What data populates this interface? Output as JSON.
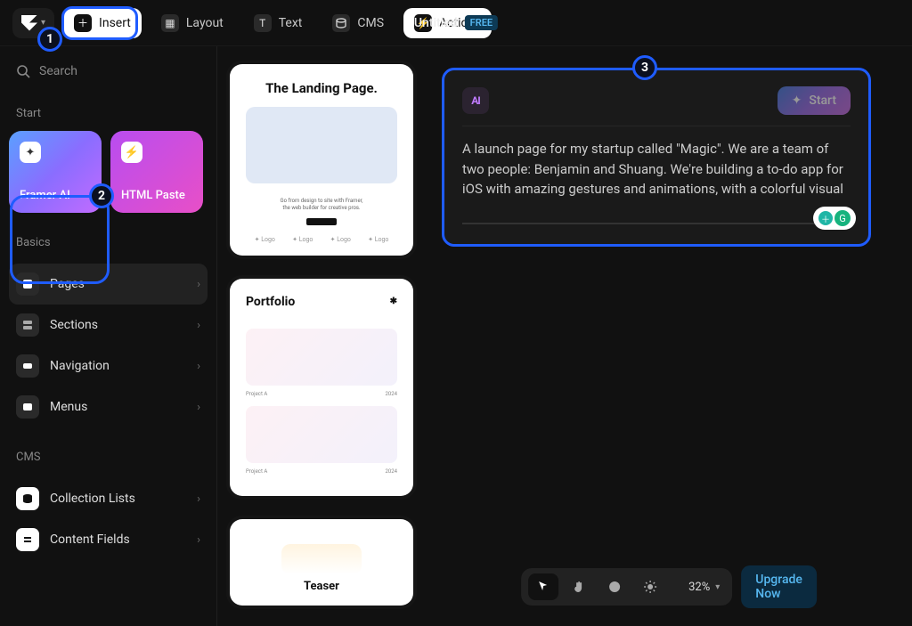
{
  "toolbar": {
    "insert": "Insert",
    "layout": "Layout",
    "text": "Text",
    "cms": "CMS",
    "actions": "Actions"
  },
  "doc": {
    "title": "Untitled",
    "plan_badge": "FREE"
  },
  "left": {
    "search_placeholder": "Search",
    "start_label": "Start",
    "tile_ai": "Framer AI",
    "tile_html": "HTML Paste",
    "basics_label": "Basics",
    "basics": [
      {
        "label": "Pages"
      },
      {
        "label": "Sections"
      },
      {
        "label": "Navigation"
      },
      {
        "label": "Menus"
      }
    ],
    "cms_label": "CMS",
    "cms": [
      {
        "label": "Collection Lists"
      },
      {
        "label": "Content Fields"
      }
    ]
  },
  "templates": {
    "landing_title": "The Landing Page.",
    "landing_caption1": "Go from design to site with Framer,",
    "landing_caption2": "the web builder for creative pros.",
    "logo_word": "Logo",
    "portfolio_title": "Portfolio",
    "project_a": "Project A",
    "project_year": "2024",
    "teaser_title": "Teaser"
  },
  "ai": {
    "icon_text": "AI",
    "start_label": "Start",
    "prompt": "A launch page for my startup called \"Magic\". We are a team of two people: Benjamin and Shuang. We're building a to-do app for iOS with amazing gestures and animations, with a colorful visual style."
  },
  "bottom": {
    "zoom": "32%",
    "upgrade": "Upgrade Now"
  },
  "callouts": {
    "one": "1",
    "two": "2",
    "three": "3"
  }
}
